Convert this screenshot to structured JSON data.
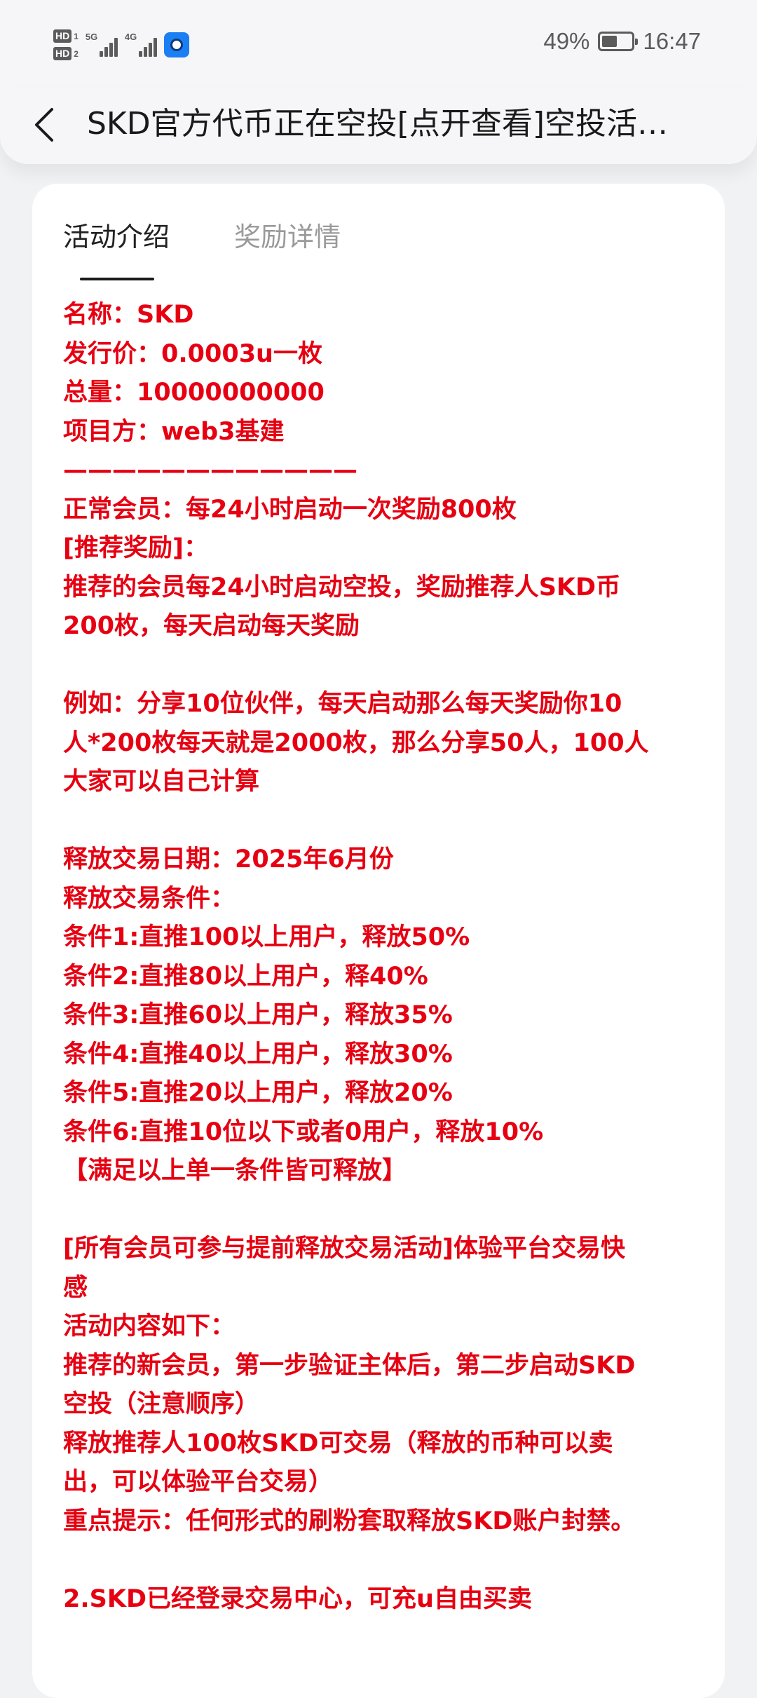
{
  "status_bar": {
    "hd1": "HD",
    "hd1_num": "1",
    "hd2": "HD",
    "hd2_num": "2",
    "net1": "5G",
    "net2": "4G",
    "battery_percent": "49%",
    "battery_level": 0.49,
    "time": "16:47"
  },
  "header": {
    "back_icon": "chevron-left-icon",
    "title": "SKD官方代币正在空投[点开查看]空投活动进行中"
  },
  "tabs": [
    {
      "label": "活动介绍",
      "active": true
    },
    {
      "label": "奖励详情",
      "active": false
    }
  ],
  "content": {
    "color": "#e60012",
    "lines": [
      "名称：SKD",
      "发行价：0.0003u一枚",
      "总量：10000000000",
      "项目方：web3基建",
      "————————————",
      "正常会员：每24小时启动一次奖励800枚",
      "[推荐奖励]：",
      "推荐的会员每24小时启动空投，奖励推荐人SKD币",
      "200枚，每天启动每天奖励",
      "",
      "例如：分享10位伙伴，每天启动那么每天奖励你10",
      "人*200枚每天就是2000枚，那么分享50人，100人",
      "大家可以自己计算",
      "",
      "释放交易日期：2025年6月份",
      "释放交易条件：",
      "条件1:直推100以上用户，释放50%",
      "条件2:直推80以上用户，释40%",
      "条件3:直推60以上用户，释放35%",
      "条件4:直推40以上用户，释放30%",
      "条件5:直推20以上用户，释放20%",
      "条件6:直推10位以下或者0用户，释放10%",
      "【满足以上单一条件皆可释放】",
      "",
      "[所有会员可参与提前释放交易活动]体验平台交易快",
      "感",
      "活动内容如下：",
      "推荐的新会员，第一步验证主体后，第二步启动SKD",
      "空投（注意顺序）",
      "释放推荐人100枚SKD可交易（释放的币种可以卖",
      "出，可以体验平台交易）",
      "重点提示：任何形式的刷粉套取释放SKD账户封禁。",
      "",
      "2.SKD已经登录交易中心，可充u自由买卖"
    ]
  }
}
